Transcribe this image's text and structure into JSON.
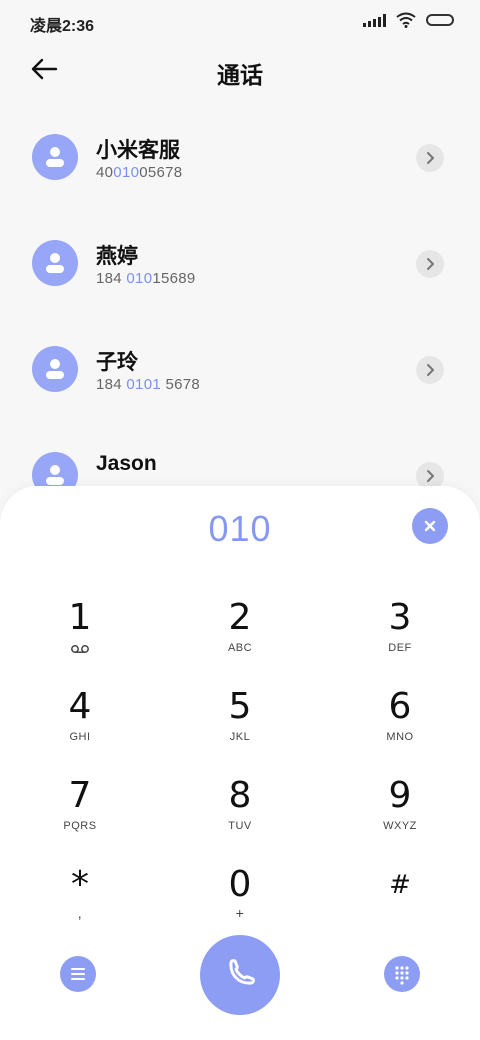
{
  "status_bar": {
    "time": "凌晨2:36"
  },
  "header": {
    "title": "通话"
  },
  "contacts": [
    {
      "name": "小米客服",
      "number_pre": "40",
      "number_match": "010",
      "number_post": "05678"
    },
    {
      "name": "燕婷",
      "number_pre": "184 ",
      "number_match": "010",
      "number_post": "15689"
    },
    {
      "name": "子玲",
      "number_pre": "184 ",
      "number_match": "0101",
      "number_post": " 5678"
    },
    {
      "name": "Jason",
      "number_pre": "",
      "number_match": "",
      "number_post": ""
    }
  ],
  "dialer": {
    "number": "010",
    "keys": [
      {
        "digit": "1",
        "letters": ""
      },
      {
        "digit": "2",
        "letters": "ABC"
      },
      {
        "digit": "3",
        "letters": "DEF"
      },
      {
        "digit": "4",
        "letters": "GHI"
      },
      {
        "digit": "5",
        "letters": "JKL"
      },
      {
        "digit": "6",
        "letters": "MNO"
      },
      {
        "digit": "7",
        "letters": "PQRS"
      },
      {
        "digit": "8",
        "letters": "TUV"
      },
      {
        "digit": "9",
        "letters": "WXYZ"
      },
      {
        "digit": "*",
        "letters": ","
      },
      {
        "digit": "0",
        "letters": "+"
      },
      {
        "digit": "#",
        "letters": ""
      }
    ]
  },
  "colors": {
    "accent": "#8d9df4",
    "highlight": "#7b8ff0",
    "avatar": "#97a6f7"
  },
  "icons": {
    "back": "arrow-left-icon",
    "avatar": "person-icon",
    "row_action": "chevron-right-icon",
    "clear": "close-icon",
    "voicemail": "voicemail-icon",
    "menu": "menu-icon",
    "call": "phone-icon",
    "keypad": "keypad-icon"
  }
}
